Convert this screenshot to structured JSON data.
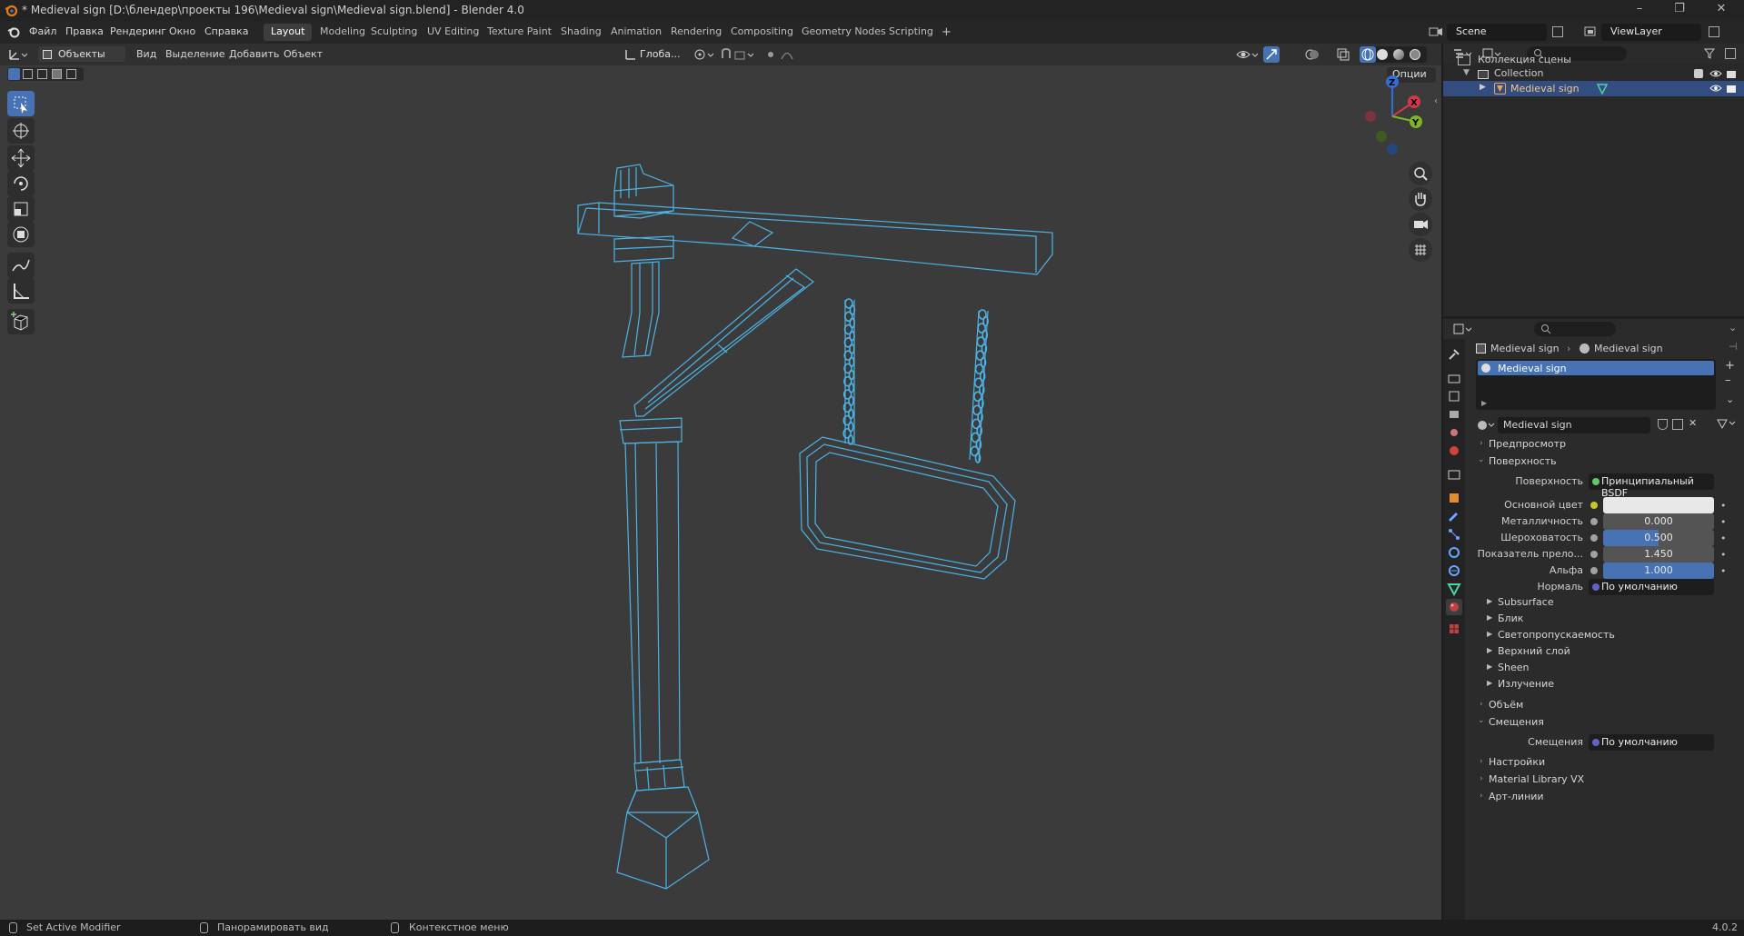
{
  "window": {
    "title": "* Medieval sign [D:\\блендер\\проекты 196\\Medieval sign\\Medieval sign.blend] - Blender 4.0",
    "minimize": "–",
    "maximize": "❐",
    "close": "✕"
  },
  "menu": [
    "Файл",
    "Правка",
    "Рендеринг",
    "Окно",
    "Справка"
  ],
  "workspaces": [
    "Layout",
    "Modeling",
    "Sculpting",
    "UV Editing",
    "Texture Paint",
    "Shading",
    "Animation",
    "Rendering",
    "Compositing",
    "Geometry Nodes",
    "Scripting"
  ],
  "workspace_add": "+",
  "scene": "Scene",
  "view_layer": "ViewLayer",
  "viewport": {
    "mode": "Объекты",
    "menus": [
      "Вид",
      "Выделение",
      "Добавить",
      "Объект"
    ],
    "transform_orientation": "Глоба...",
    "options": "Опции",
    "gizmo_axes": {
      "x": "X",
      "y": "Y",
      "z": "Z"
    }
  },
  "outliner": {
    "root": "Коллекция сцены",
    "collection": "Collection",
    "object": "Medieval sign"
  },
  "properties": {
    "breadcrumb": {
      "object": "Medieval sign",
      "material": "Medieval sign"
    },
    "material_slot": "Medieval sign",
    "material_name": "Medieval sign",
    "preview": "Предпросмотр",
    "surface_section": "Поверхность",
    "surface_label": "Поверхность",
    "surface_value": "Принципиальный BSDF",
    "base_color_label": "Основной цвет",
    "base_color": "#e8e8e8",
    "metallic_label": "Металличность",
    "metallic": "0.000",
    "roughness_label": "Шероховатость",
    "roughness": "0.500",
    "roughness_fraction": 0.5,
    "ior_label": "Показатель прело...",
    "ior": "1.450",
    "alpha_label": "Альфа",
    "alpha": "1.000",
    "alpha_fraction": 1.0,
    "normal_label": "Нормаль",
    "normal_value": "По умолчанию",
    "subpanels": [
      "Subsurface",
      "Блик",
      "Светопропускаемость",
      "Верхний слой",
      "Sheen",
      "Излучение"
    ],
    "volume": "Объём",
    "displacement_section": "Смещения",
    "displacement_label": "Смещения",
    "displacement_value": "По умолчанию",
    "settings": "Настройки",
    "material_library": "Material Library VX",
    "line_art": "Арт-линии"
  },
  "status": {
    "left": "Set Active Modifier",
    "middle": "Панорамировать вид",
    "right": "Контекстное меню",
    "version": "4.0.2"
  },
  "colors": {
    "accent": "#4772b3",
    "wire": "#4cb3e6",
    "bg": "#3b3b3b"
  }
}
